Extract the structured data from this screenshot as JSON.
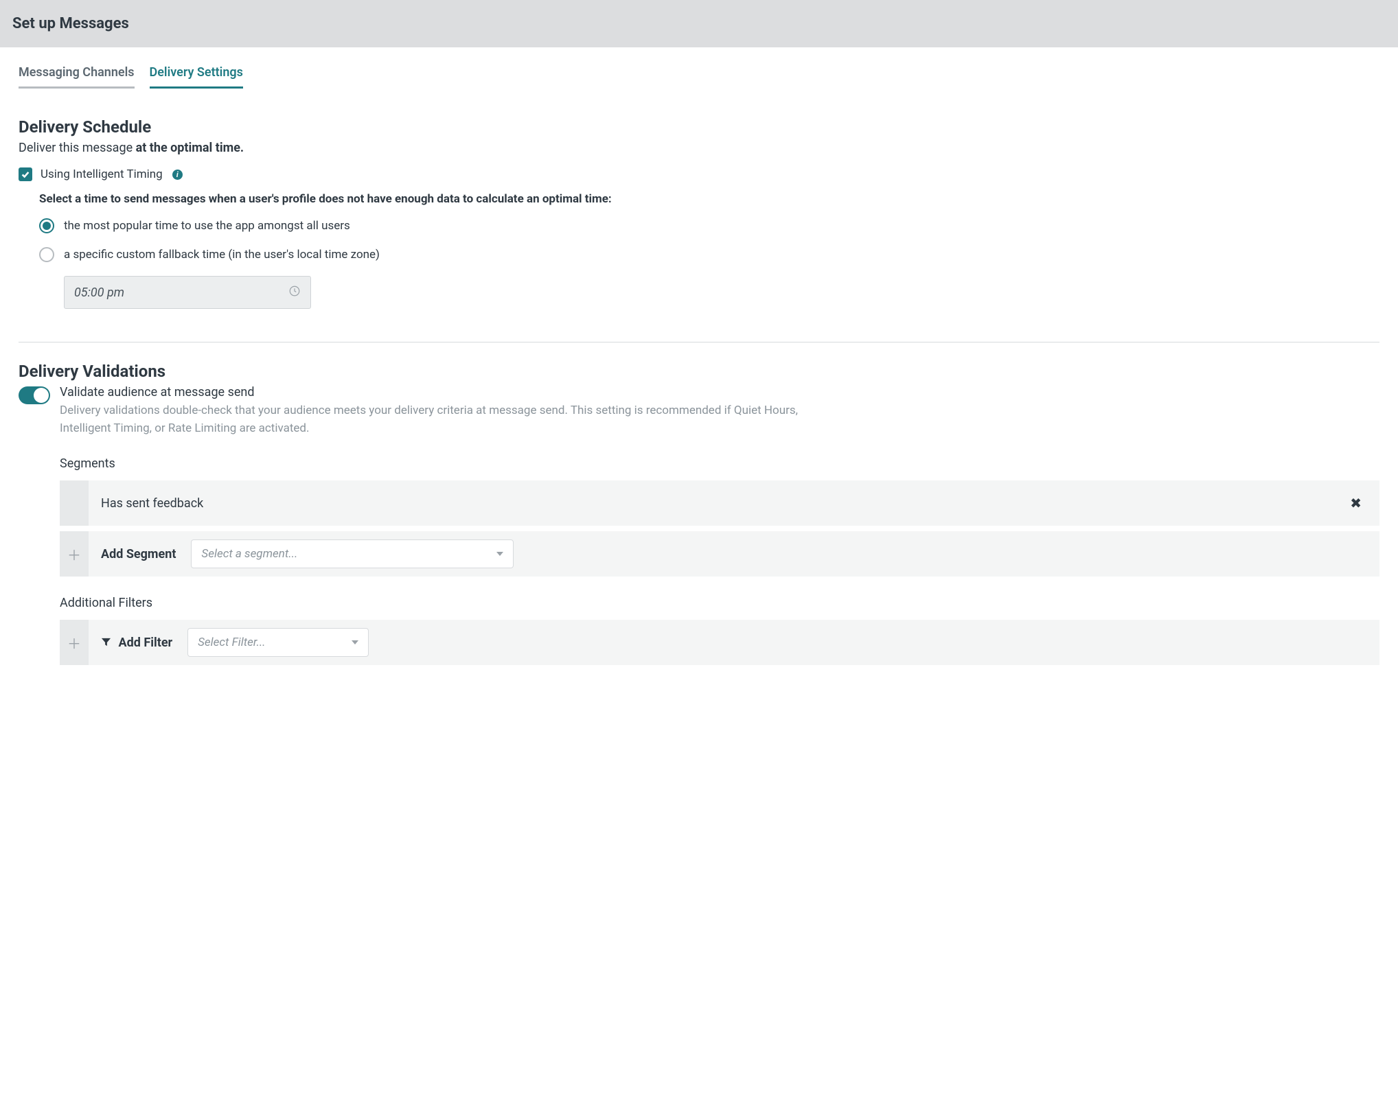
{
  "header": {
    "title": "Set up Messages"
  },
  "tabs": {
    "messaging": "Messaging Channels",
    "delivery": "Delivery Settings"
  },
  "schedule": {
    "heading": "Delivery Schedule",
    "subline_prefix": "Deliver this message ",
    "subline_bold": "at the optimal time.",
    "intelligent_label": "Using Intelligent Timing",
    "fallback_title": "Select a time to send messages when a user's profile does not have enough data to calculate an optimal time:",
    "option_popular": "the most popular time to use the app amongst all users",
    "option_custom": "a specific custom fallback time (in the user's local time zone)",
    "fallback_time": "05:00 pm"
  },
  "validations": {
    "heading": "Delivery Validations",
    "toggle_label": "Validate audience at message send",
    "toggle_desc": "Delivery validations double-check that your audience meets your delivery criteria at message send. This setting is recommended if Quiet Hours, Intelligent Timing, or Rate Limiting are activated.",
    "segments_heading": "Segments",
    "segment_item": "Has sent feedback",
    "add_segment_label": "Add Segment",
    "segment_select_placeholder": "Select a segment...",
    "filters_heading": "Additional Filters",
    "add_filter_label": "Add Filter",
    "filter_select_placeholder": "Select Filter..."
  }
}
